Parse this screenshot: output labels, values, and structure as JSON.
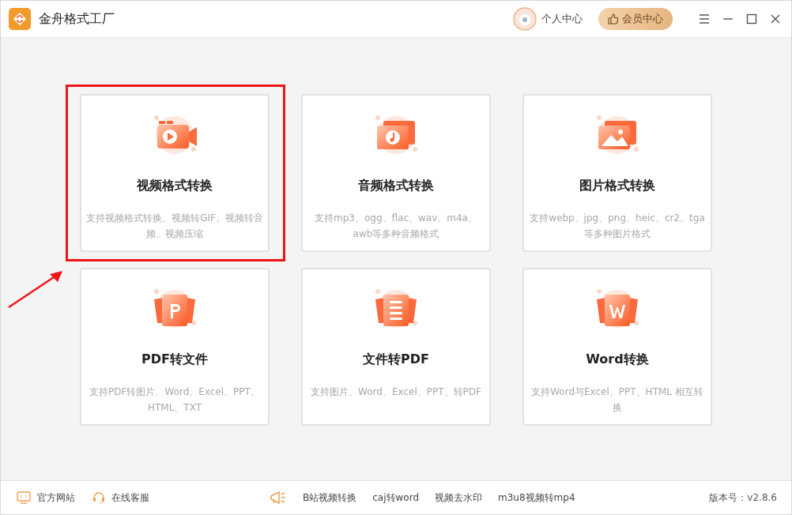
{
  "window": {
    "title": "金舟格式工厂"
  },
  "header": {
    "profile": "个人中心",
    "vip": "会员中心"
  },
  "cards": [
    {
      "kind": "video",
      "title": "视频格式转换",
      "description": "支持视频格式转换、视频转GIF、视频转音频、视频压缩",
      "highlighted": true
    },
    {
      "kind": "audio",
      "title": "音频格式转换",
      "description": "支持mp3、ogg、flac、wav、m4a、awb等多种音频格式",
      "highlighted": false
    },
    {
      "kind": "image",
      "title": "图片格式转换",
      "description": "支持webp、jpg、png、heic、cr2、tga等多种图片格式",
      "highlighted": false
    },
    {
      "kind": "pdf",
      "title": "PDF转文件",
      "description": "支持PDF转图片、Word、Excel、PPT、HTML、TXT",
      "highlighted": false
    },
    {
      "kind": "doc",
      "title": "文件转PDF",
      "description": "支持图片、Word、Excel、PPT、转PDF",
      "highlighted": false
    },
    {
      "kind": "word",
      "title": "Word转换",
      "description": "支持Word与Excel、PPT、HTML 相互转换",
      "highlighted": false
    }
  ],
  "footer": {
    "links": [
      {
        "kind": "site",
        "label": "官方网站"
      },
      {
        "kind": "support",
        "label": "在线客服"
      }
    ],
    "promo": [
      "B站视频转换",
      "caj转word",
      "视频去水印",
      "m3u8视频转mp4"
    ],
    "version": "版本号：v2.8.6"
  }
}
